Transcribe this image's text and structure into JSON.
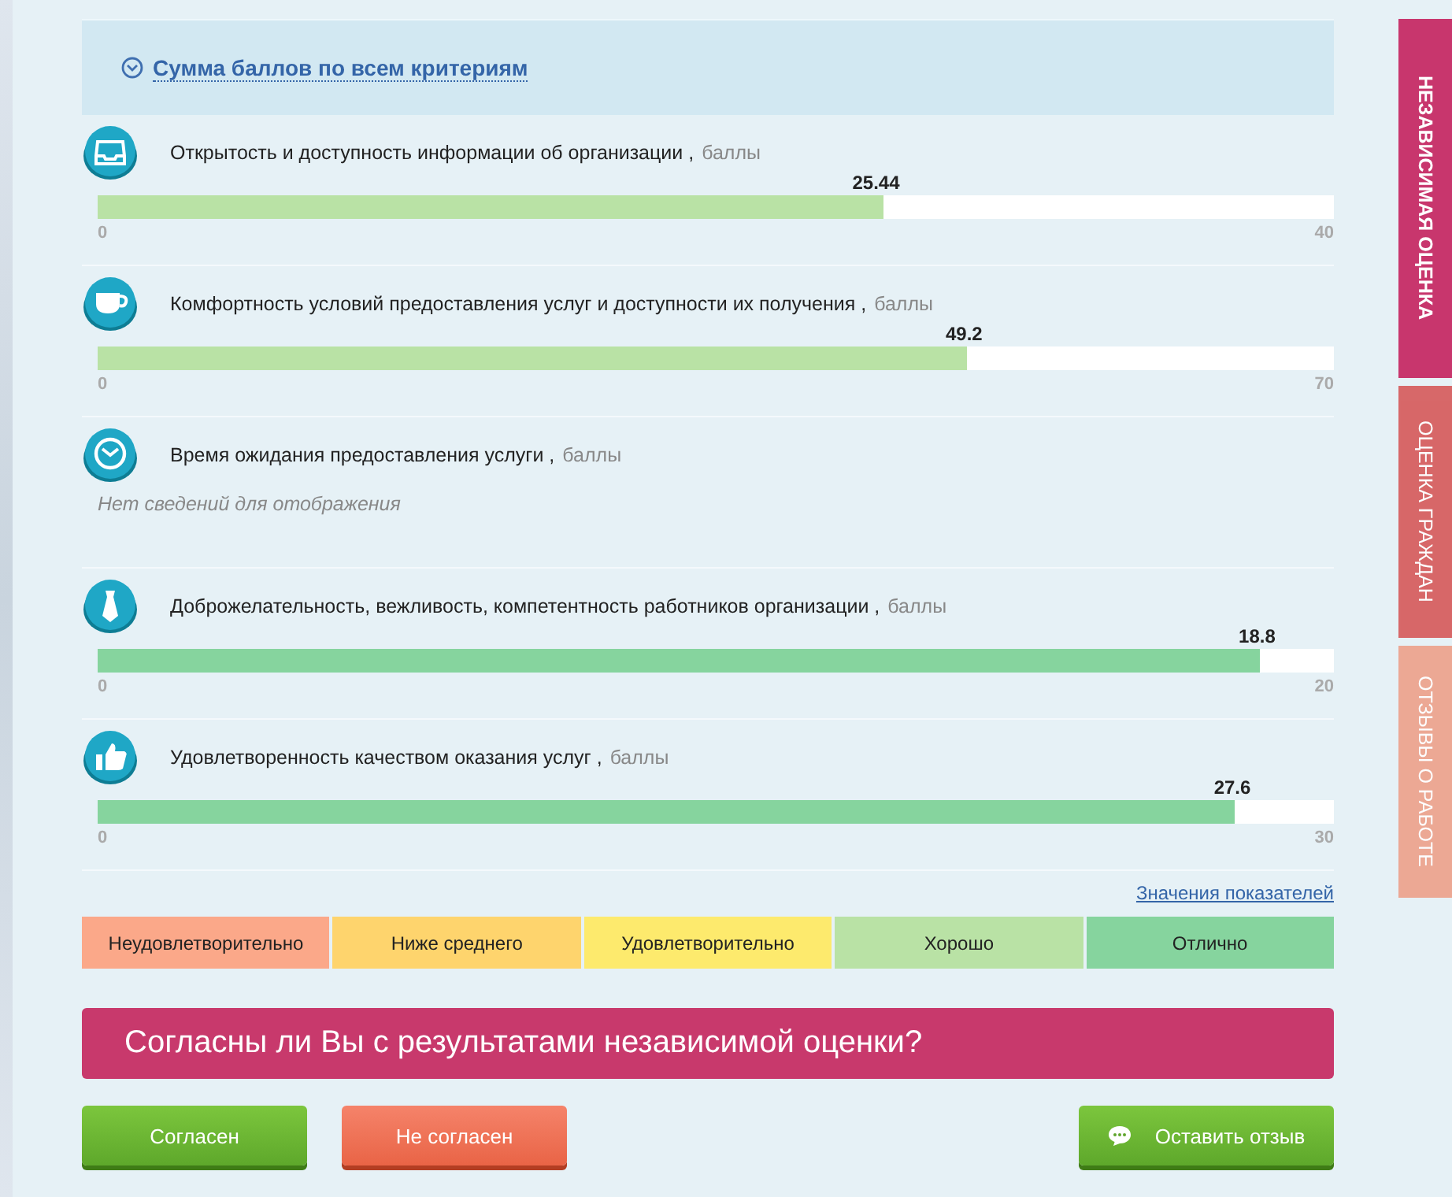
{
  "summary_toggle": {
    "label": "Сумма баллов по всем критериям",
    "expanded": true
  },
  "criteria": [
    {
      "kind": "tray",
      "title": "Открытость и доступность информации об организации ,",
      "unit": "баллы",
      "value": "25.44",
      "min": "0",
      "max": "40",
      "level": 0.636,
      "color": "#b9e2a5"
    },
    {
      "kind": "cup",
      "title": "Комфортность условий предоставления услуг и доступности их получения ,",
      "unit": "баллы",
      "value": "49.2",
      "min": "0",
      "max": "70",
      "level": 0.703,
      "color": "#b9e2a5"
    },
    {
      "kind": "clock",
      "title": "Время ожидания предоставления услуги ,",
      "unit": "баллы",
      "no_data": "Нет сведений для отображения"
    },
    {
      "kind": "tie",
      "title": "Доброжелательность, вежливость, компетентность работников организации ,",
      "unit": "баллы",
      "value": "18.8",
      "min": "0",
      "max": "20",
      "level": 0.94,
      "color": "#86d49e"
    },
    {
      "kind": "thumb",
      "title": "Удовлетворенность качеством оказания услуг ,",
      "unit": "баллы",
      "value": "27.6",
      "min": "0",
      "max": "30",
      "level": 0.92,
      "color": "#86d49e"
    }
  ],
  "legend_link": "Значения показателей",
  "legend": [
    {
      "label": "Неудовлетворительно",
      "color": "#fba889"
    },
    {
      "label": "Ниже среднего",
      "color": "#fed46d"
    },
    {
      "label": "Удовлетворительно",
      "color": "#fdea6d"
    },
    {
      "label": "Хорошо",
      "color": "#b9e2a5"
    },
    {
      "label": "Отлично",
      "color": "#86d49e"
    }
  ],
  "question": "Согласны ли Вы с результатами независимой оценки?",
  "buttons": [
    {
      "kind": "agree",
      "label": "Согласен"
    },
    {
      "kind": "disagree",
      "label": "Не согласен"
    },
    {
      "kind": "review",
      "label": "Оставить отзыв"
    }
  ],
  "side_tabs": [
    {
      "label": "НЕЗАВИСИМАЯ ОЦЕНКА",
      "selected": true
    },
    {
      "label": "ОЦЕНКА ГРАЖДАН",
      "selected": false
    },
    {
      "label": "ОТЗЫВЫ О РАБОТЕ",
      "selected": false
    }
  ]
}
